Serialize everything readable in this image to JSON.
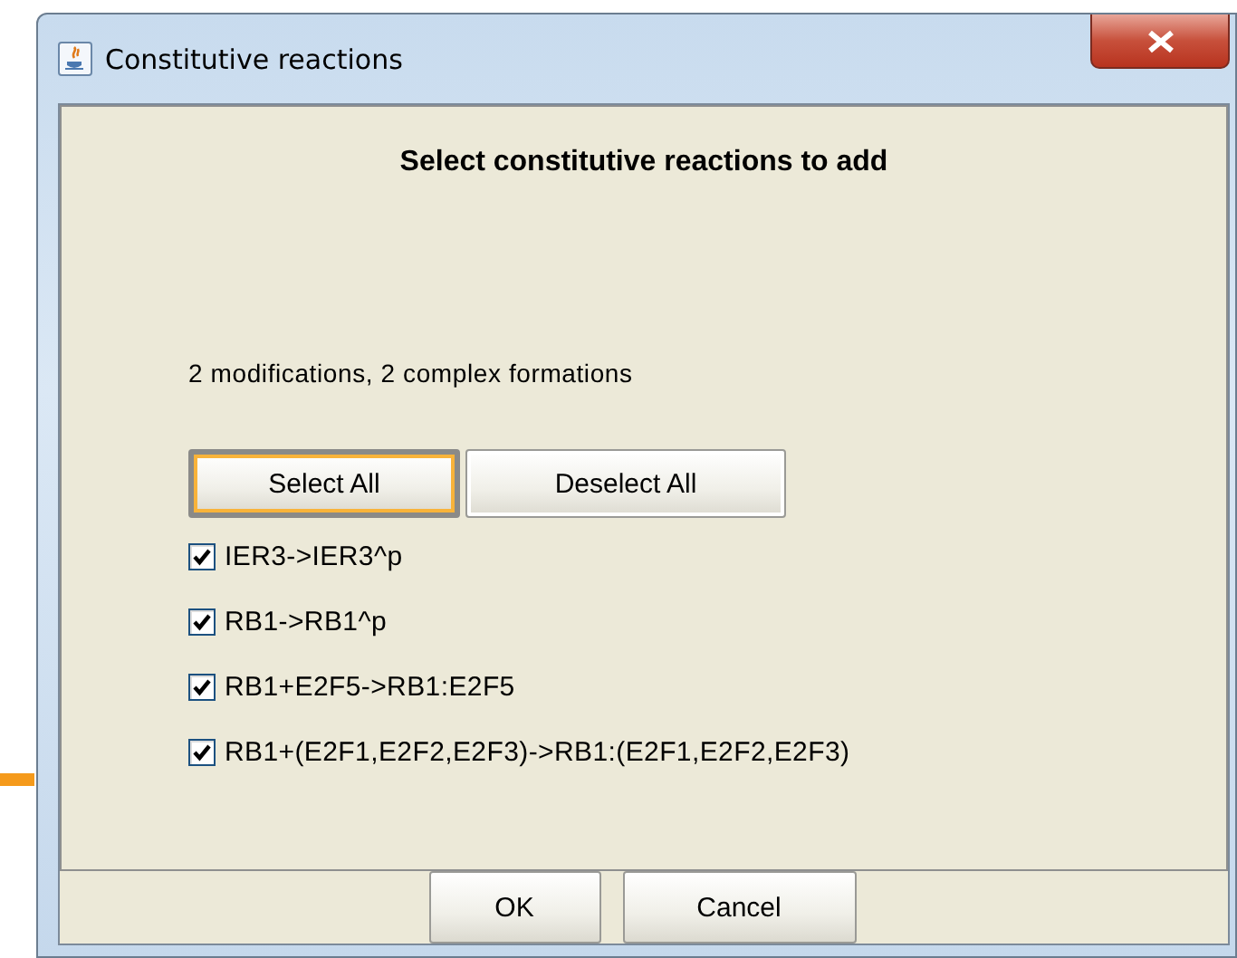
{
  "window": {
    "title": "Constitutive reactions"
  },
  "heading": "Select constitutive reactions to add",
  "summary": "2 modifications, 2 complex formations",
  "selection_buttons": [
    {
      "label": "Select All",
      "focused": true
    },
    {
      "label": "Deselect All",
      "focused": false
    }
  ],
  "reactions": [
    {
      "label": "IER3->IER3^p",
      "checked": true
    },
    {
      "label": "RB1->RB1^p",
      "checked": true
    },
    {
      "label": "RB1+E2F5->RB1:E2F5",
      "checked": true
    },
    {
      "label": "RB1+(E2F1,E2F2,E2F3)->RB1:(E2F1,E2F2,E2F3)",
      "checked": true
    }
  ],
  "buttons": [
    "OK",
    "Cancel"
  ]
}
